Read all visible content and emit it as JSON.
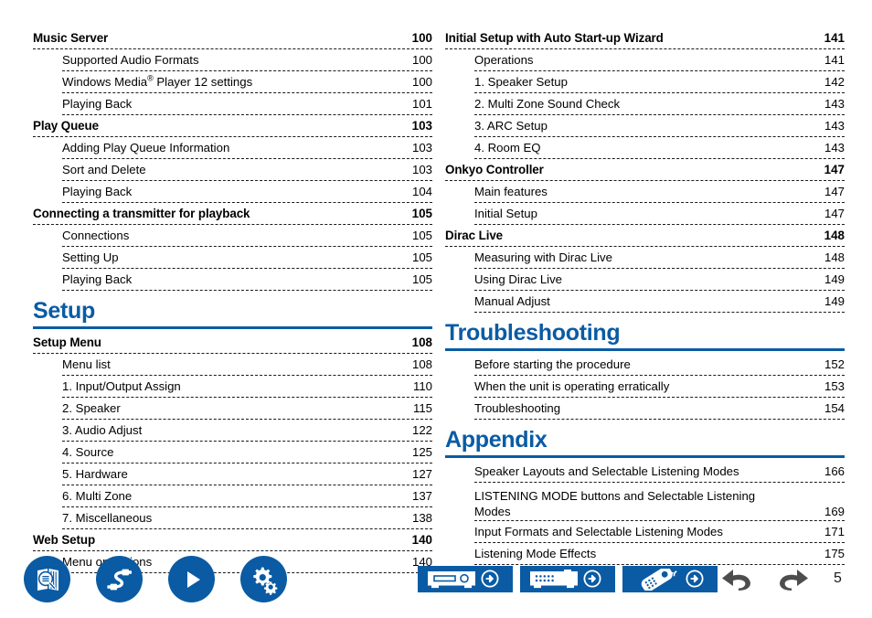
{
  "page": {
    "number": "5",
    "accent_color": "#0a5ba4",
    "text_color": "#1a1a1a"
  },
  "columns": [
    {
      "name": "left-column",
      "blocks": [
        {
          "type": "toc",
          "entries": [
            {
              "level": 1,
              "title": "Music Server",
              "page": "100"
            },
            {
              "level": 2,
              "title": "Supported Audio Formats",
              "page": "100"
            },
            {
              "level": 2,
              "title": "Windows Media® Player 12 settings",
              "page": "100",
              "has_reg": true,
              "pre": "Windows Media",
              "post": " Player 12 settings"
            },
            {
              "level": 2,
              "title": "Playing Back",
              "page": "101"
            },
            {
              "level": 1,
              "title": "Play Queue",
              "page": "103"
            },
            {
              "level": 2,
              "title": "Adding Play Queue Information",
              "page": "103"
            },
            {
              "level": 2,
              "title": "Sort and Delete",
              "page": "103"
            },
            {
              "level": 2,
              "title": "Playing Back",
              "page": "104"
            },
            {
              "level": 1,
              "title": "Connecting a transmitter for playback",
              "page": "105"
            },
            {
              "level": 2,
              "title": "Connections",
              "page": "105"
            },
            {
              "level": 2,
              "title": "Setting Up",
              "page": "105"
            },
            {
              "level": 2,
              "title": "Playing Back",
              "page": "105"
            }
          ]
        },
        {
          "type": "section",
          "title": "Setup"
        },
        {
          "type": "toc",
          "entries": [
            {
              "level": 1,
              "title": "Setup Menu",
              "page": "108"
            },
            {
              "level": 2,
              "title": "Menu list",
              "page": "108"
            },
            {
              "level": 2,
              "title": "1. Input/Output Assign",
              "page": "110"
            },
            {
              "level": 2,
              "title": "2. Speaker",
              "page": "115"
            },
            {
              "level": 2,
              "title": "3. Audio Adjust",
              "page": "122"
            },
            {
              "level": 2,
              "title": "4. Source",
              "page": "125"
            },
            {
              "level": 2,
              "title": "5. Hardware",
              "page": "127"
            },
            {
              "level": 2,
              "title": "6. Multi Zone",
              "page": "137"
            },
            {
              "level": 2,
              "title": "7. Miscellaneous",
              "page": "138"
            },
            {
              "level": 1,
              "title": "Web Setup",
              "page": "140"
            },
            {
              "level": 2,
              "title": "Menu operations",
              "page": "140"
            }
          ]
        }
      ]
    },
    {
      "name": "right-column",
      "blocks": [
        {
          "type": "toc",
          "entries": [
            {
              "level": 1,
              "title": "Initial Setup with Auto Start-up Wizard",
              "page": "141"
            },
            {
              "level": 2,
              "title": "Operations",
              "page": "141"
            },
            {
              "level": 2,
              "title": "1. Speaker Setup",
              "page": "142"
            },
            {
              "level": 2,
              "title": "2. Multi Zone Sound Check",
              "page": "143"
            },
            {
              "level": 2,
              "title": "3. ARC Setup",
              "page": "143"
            },
            {
              "level": 2,
              "title": "4. Room EQ",
              "page": "143"
            },
            {
              "level": 1,
              "title": "Onkyo Controller",
              "page": "147"
            },
            {
              "level": 2,
              "title": "Main features",
              "page": "147"
            },
            {
              "level": 2,
              "title": "Initial Setup",
              "page": "147"
            },
            {
              "level": 1,
              "title": "Dirac Live",
              "page": "148"
            },
            {
              "level": 2,
              "title": "Measuring with Dirac Live",
              "page": "148"
            },
            {
              "level": 2,
              "title": "Using Dirac Live",
              "page": "149"
            },
            {
              "level": 2,
              "title": "Manual Adjust",
              "page": "149"
            }
          ]
        },
        {
          "type": "section",
          "title": "Troubleshooting"
        },
        {
          "type": "toc",
          "entries": [
            {
              "level": 2,
              "title": "Before starting the procedure",
              "page": "152"
            },
            {
              "level": 2,
              "title": "When the unit is operating erratically",
              "page": "153"
            },
            {
              "level": 2,
              "title": "Troubleshooting",
              "page": "154"
            }
          ]
        },
        {
          "type": "section",
          "title": "Appendix"
        },
        {
          "type": "toc",
          "entries": [
            {
              "level": 2,
              "title": "Speaker Layouts and Selectable Listening Modes",
              "page": "166"
            },
            {
              "level": 2,
              "title": "LISTENING MODE buttons and Selectable Listening Modes",
              "page": "169",
              "wrap": true
            },
            {
              "level": 2,
              "title": "Input Formats and Selectable Listening Modes",
              "page": "171"
            },
            {
              "level": 2,
              "title": "Listening Mode Effects",
              "page": "175"
            }
          ]
        }
      ]
    }
  ],
  "footer": {
    "left_icons": [
      {
        "name": "book-search-icon",
        "label": "Basic Manual / Search"
      },
      {
        "name": "cable-connection-icon",
        "label": "Connections"
      },
      {
        "name": "play-icon",
        "label": "Playback"
      },
      {
        "name": "gears-setup-icon",
        "label": "Setup"
      }
    ],
    "device_icons": [
      {
        "name": "front-panel-icon",
        "label": "Front Panel"
      },
      {
        "name": "rear-panel-icon",
        "label": "Rear Panel"
      },
      {
        "name": "remote-control-icon",
        "label": "Remote Controller"
      }
    ],
    "nav": [
      {
        "name": "back-arrow-icon",
        "label": "Back"
      },
      {
        "name": "forward-arrow-icon",
        "label": "Forward"
      }
    ]
  }
}
